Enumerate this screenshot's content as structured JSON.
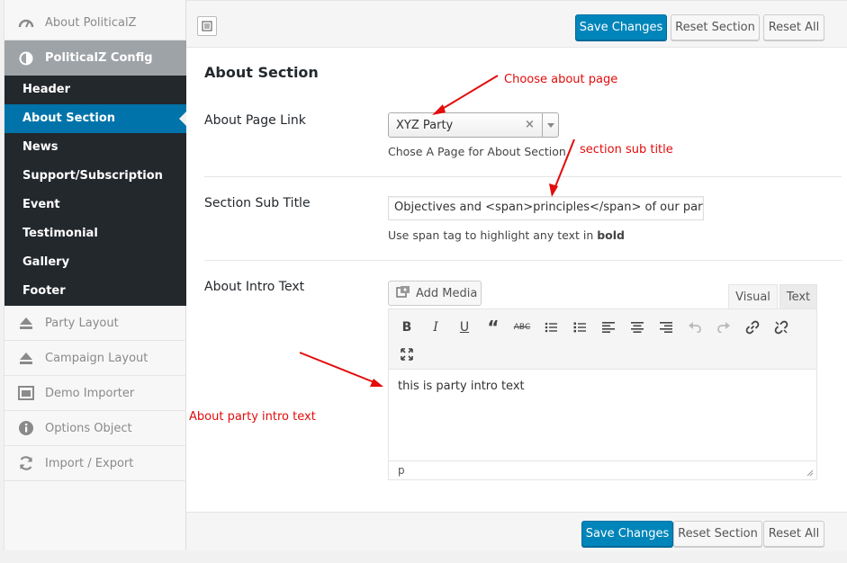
{
  "sidebar": {
    "top_items": [
      {
        "label": "About PoliticalZ",
        "icon": "dashboard-gauge-icon"
      },
      {
        "label": "PoliticalZ Config",
        "icon": "half-circle-icon"
      }
    ],
    "submenu": [
      {
        "label": "Header"
      },
      {
        "label": "About Section"
      },
      {
        "label": "News"
      },
      {
        "label": "Support/Subscription"
      },
      {
        "label": "Event"
      },
      {
        "label": "Testimonial"
      },
      {
        "label": "Gallery"
      },
      {
        "label": "Footer"
      }
    ],
    "bottom_items": [
      {
        "label": "Party Layout",
        "icon": "eject-icon"
      },
      {
        "label": "Campaign Layout",
        "icon": "eject-icon"
      },
      {
        "label": "Demo Importer",
        "icon": "window-icon"
      },
      {
        "label": "Options Object",
        "icon": "info-icon"
      },
      {
        "label": "Import / Export",
        "icon": "refresh-icon"
      }
    ]
  },
  "toolbar": {
    "save_label": "Save Changes",
    "reset_section_label": "Reset Section",
    "reset_all_label": "Reset All"
  },
  "section": {
    "title": "About Section",
    "about_page": {
      "label": "About Page Link",
      "selected": "XYZ Party",
      "clear": "×",
      "description": "Chose A Page for About Section"
    },
    "sub_title": {
      "label": "Section Sub Title",
      "value": "Objectives and <span>principles</span> of our party to",
      "description_prefix": "Use span tag to highlight any text in",
      "description_bold": "bold"
    },
    "intro": {
      "label": "About Intro Text",
      "add_media": "Add Media",
      "tab_visual": "Visual",
      "tab_text": "Text",
      "content": "this is party intro text",
      "path": "p"
    }
  },
  "annotations": {
    "choose_page": "Choose about page",
    "sub_title": "section sub title",
    "intro": "About party intro text",
    "color": "#e30b0b"
  },
  "colors": {
    "primary": "#0085ba",
    "sidebar_dark": "#23282d",
    "active_blue": "#0073aa",
    "active_gray": "#9ea3a8"
  }
}
